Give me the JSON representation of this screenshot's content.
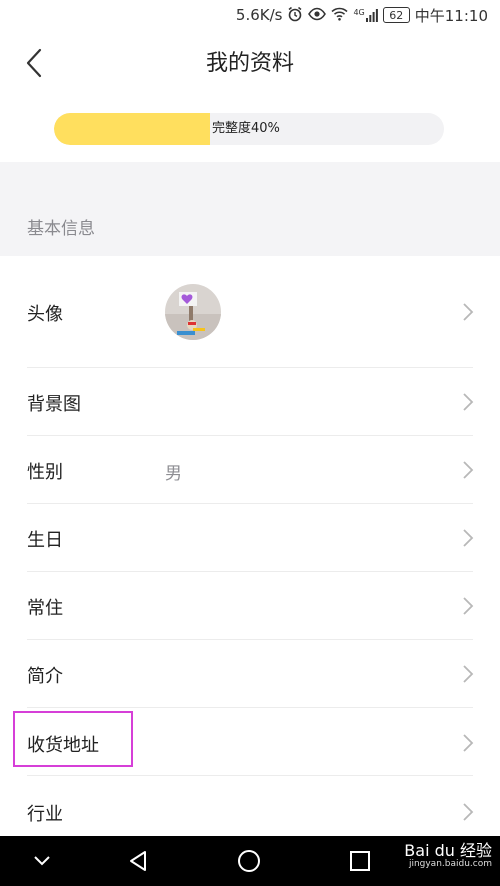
{
  "status_bar": {
    "speed": "5.6K/s",
    "network": "4G",
    "battery": "62",
    "time": "中午11:10"
  },
  "header": {
    "title": "我的资料"
  },
  "progress": {
    "label": "完整度40%",
    "percent": 40,
    "fill_color": "#ffdf5e"
  },
  "section": {
    "title": "基本信息"
  },
  "rows": [
    {
      "label": "头像",
      "value": ""
    },
    {
      "label": "背景图",
      "value": ""
    },
    {
      "label": "性别",
      "value": "男"
    },
    {
      "label": "生日",
      "value": ""
    },
    {
      "label": "常住",
      "value": ""
    },
    {
      "label": "简介",
      "value": ""
    },
    {
      "label": "收货地址",
      "value": ""
    },
    {
      "label": "行业",
      "value": ""
    }
  ],
  "watermark": {
    "brand": "Bai du 经验",
    "url": "jingyan.baidu.com"
  },
  "colors": {
    "highlight": "#d63fd8",
    "accent": "#ffdf5e"
  }
}
